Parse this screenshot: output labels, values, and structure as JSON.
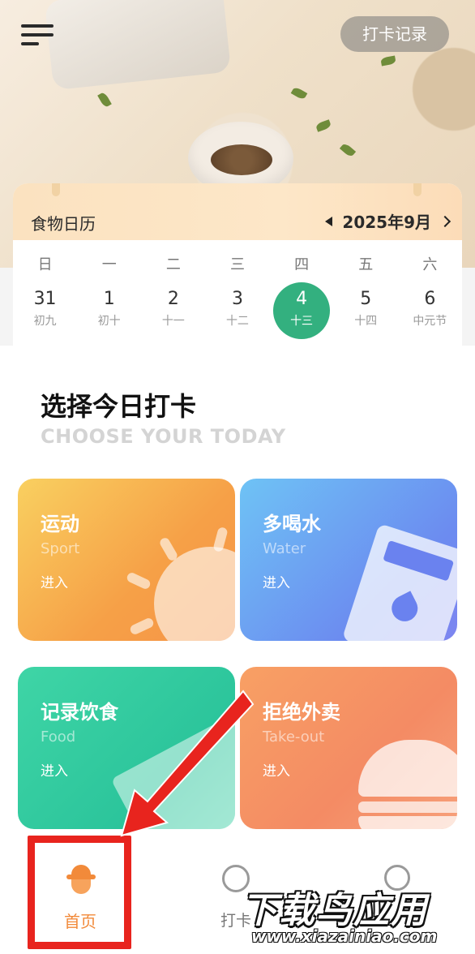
{
  "header": {
    "record_button": "打卡记录"
  },
  "calendar": {
    "title": "食物日历",
    "month": "2025年9月",
    "weekdays": [
      "日",
      "一",
      "二",
      "三",
      "四",
      "五",
      "六"
    ],
    "days": [
      {
        "num": "31",
        "lunar": "初九"
      },
      {
        "num": "1",
        "lunar": "初十"
      },
      {
        "num": "2",
        "lunar": "十一"
      },
      {
        "num": "3",
        "lunar": "十二"
      },
      {
        "num": "4",
        "lunar": "十三"
      },
      {
        "num": "5",
        "lunar": "十四"
      },
      {
        "num": "6",
        "lunar": "中元节"
      }
    ],
    "selected_index": 4,
    "selected_color": "#33b07f"
  },
  "choose": {
    "title": "选择今日打卡",
    "subtitle": "CHOOSE YOUR TODAY"
  },
  "tiles": [
    {
      "title": "运动",
      "sub": "Sport",
      "enter": "进入",
      "icon": "sun-icon"
    },
    {
      "title": "多喝水",
      "sub": "Water",
      "enter": "进入",
      "icon": "water-glass-icon"
    },
    {
      "title": "记录饮食",
      "sub": "Food",
      "enter": "进入",
      "icon": "paper-plane-icon"
    },
    {
      "title": "拒绝外卖",
      "sub": "Take-out",
      "enter": "进入",
      "icon": "burger-icon"
    }
  ],
  "nav": {
    "home_label": "首页",
    "checkin_label": "打卡",
    "active_color": "#f28a3a"
  },
  "watermark": {
    "main": "下载鸟应用",
    "url": "www.xiazainiao.com"
  },
  "annotation": {
    "highlight_color": "#e8241e"
  }
}
